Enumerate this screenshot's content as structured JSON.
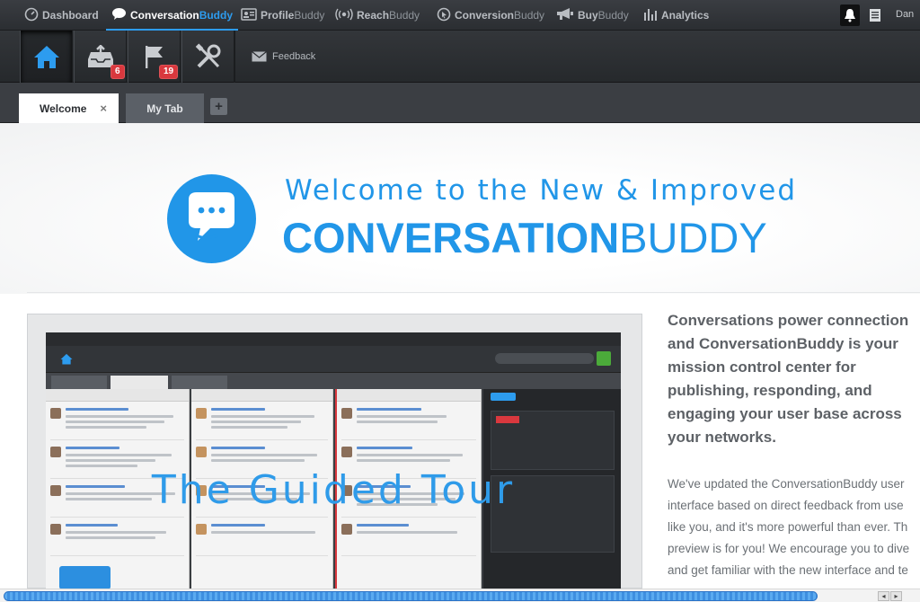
{
  "topnav": {
    "items": [
      {
        "bold": "Dashboard",
        "lite": ""
      },
      {
        "bold": "Conversation",
        "lite": "Buddy"
      },
      {
        "bold": "Profile",
        "lite": "Buddy"
      },
      {
        "bold": "Reach",
        "lite": "Buddy"
      },
      {
        "bold": "Conversion",
        "lite": "Buddy"
      },
      {
        "bold": "Buy",
        "lite": "Buddy"
      },
      {
        "bold": "Analytics",
        "lite": ""
      }
    ],
    "active_index": 1,
    "user_name": "Dan"
  },
  "toolbar": {
    "inbox_badge": "6",
    "flag_badge": "19",
    "feedback_label": "Feedback"
  },
  "tabs": {
    "welcome": "Welcome",
    "close_glyph": "×",
    "mytab": "My Tab",
    "add_glyph": "+"
  },
  "hero": {
    "line1": "Welcome to the New & Improved",
    "brand_bold": "CONVERSATION",
    "brand_light": "BUDDY"
  },
  "preview": {
    "overlay_title": "The Guided Tour"
  },
  "copy": {
    "lead": [
      "Conversations power connection",
      "and ConversationBuddy is your",
      "mission control center for",
      "publishing, responding, and",
      "engaging your user base across",
      "your networks."
    ],
    "body": [
      "We've updated the ConversationBuddy user",
      "interface based on direct feedback from use",
      "like you, and it's more powerful than ever. Th",
      "preview is for you! We encourage you to dive",
      "and get familiar with the new interface and te"
    ]
  },
  "colors": {
    "brand_blue": "#2196e8",
    "badge_red": "#d9383e",
    "nav_dark": "#2b2e32"
  }
}
